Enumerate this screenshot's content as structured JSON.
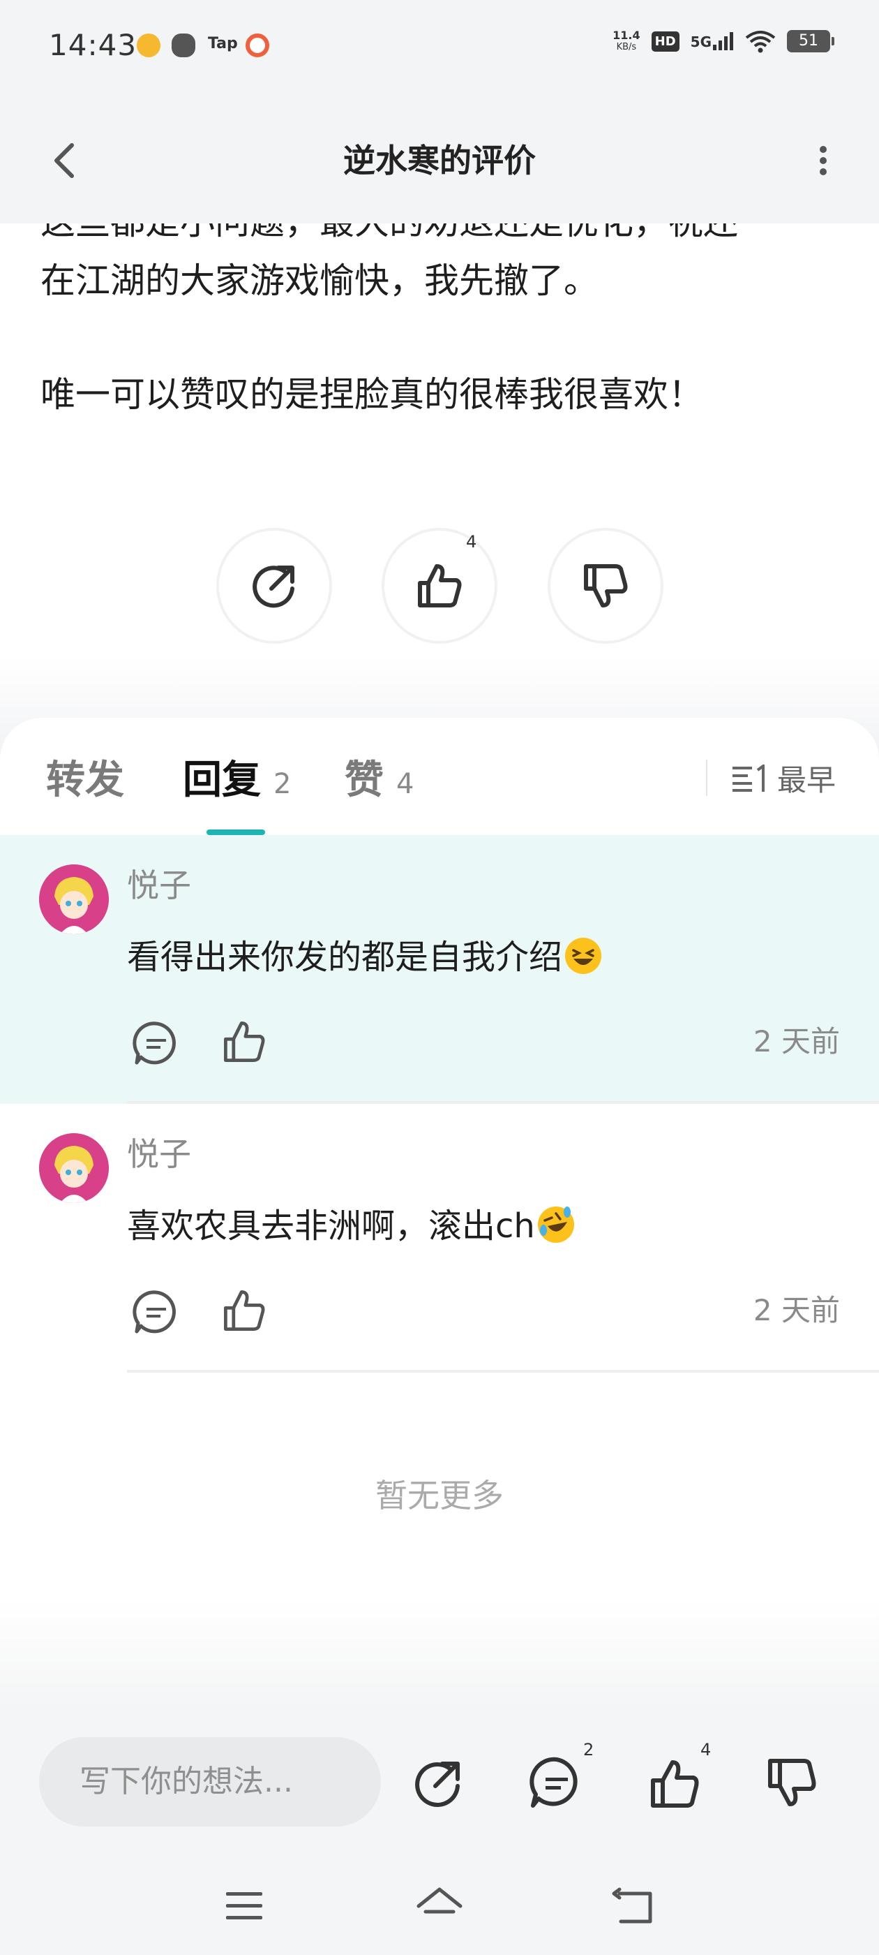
{
  "status_bar": {
    "time": "14:43",
    "net_speed_value": "11.4",
    "net_speed_unit": "KB/s",
    "hd_label": "HD",
    "network_label": "5G",
    "battery_level": "51",
    "tap_app_label": "Tap"
  },
  "header": {
    "title": "逆水寒的评价"
  },
  "review": {
    "partial_line": "这些都是小问题，最大的劝退还是优化，祝还",
    "line_2": "在江湖的大家游戏愉快，我先撤了。",
    "line_3": "唯一可以赞叹的是捏脸真的很棒我很喜欢！",
    "like_count": "4"
  },
  "tabs": {
    "forward_label": "转发",
    "reply_label": "回复",
    "reply_count": "2",
    "like_label": "赞",
    "like_count": "4",
    "sort_label": "最早",
    "active_tab": "回复"
  },
  "comments": [
    {
      "author": "悦子",
      "text": "看得出来你发的都是自我介绍",
      "emoji": "grinning-squinting-face",
      "time": "2 天前",
      "highlighted": true
    },
    {
      "author": "悦子",
      "text": "喜欢农具去非洲啊，滚出ch",
      "emoji": "rolling-on-floor-laughing-face",
      "time": "2 天前",
      "highlighted": false
    }
  ],
  "list_end": {
    "text": "暂无更多"
  },
  "bottom_bar": {
    "input_placeholder": "写下你的想法...",
    "comment_count": "2",
    "like_count": "4"
  },
  "colors": {
    "accent": "#1cb5b3",
    "highlight_background": "#ebf8f8",
    "header_background": "#f3f4f6"
  }
}
